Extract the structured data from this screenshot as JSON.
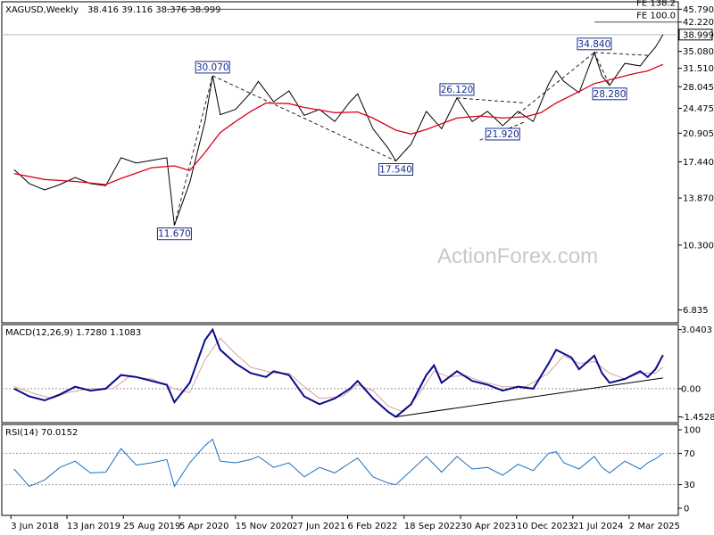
{
  "header": {
    "symbol": "XAGUSD,Weekly",
    "ohlc": "38.416 39.116 38.376 38.999"
  },
  "watermark": "ActionForex.com",
  "colors": {
    "price": "#000000",
    "sma": "#d9001b",
    "macd": "#0a0a8c",
    "signal": "#d9a0a0",
    "rsi": "#1a6fc2",
    "label_border": "#1a2d8f",
    "fib_line": "#3a4f6e"
  },
  "chart_data": [
    {
      "panel": "price",
      "type": "line",
      "title": "XAGUSD,Weekly 38.416 39.116 38.376 38.999",
      "y_scale": "log",
      "ylim": [
        6.3,
        48.0
      ],
      "y_ticks": [
        "45.790",
        "42.220",
        "38.999",
        "35.080",
        "31.510",
        "28.045",
        "24.475",
        "20.905",
        "17.440",
        "13.870",
        "10.300",
        "6.835"
      ],
      "y_tick_values": [
        45.79,
        42.22,
        38.999,
        35.08,
        31.51,
        28.045,
        24.475,
        20.905,
        17.44,
        13.87,
        10.3,
        6.835
      ],
      "x_labels": [
        "3 Jun 2018",
        "13 Jan 2019",
        "25 Aug 2019",
        "5 Apr 2020",
        "15 Nov 2020",
        "27 Jun 2021",
        "6 Feb 2022",
        "18 Sep 2022",
        "30 Apr 2023",
        "10 Dec 2023",
        "21 Jul 2024",
        "2 Mar 2025"
      ],
      "price_path": [
        [
          "Jun 2018",
          16.6
        ],
        [
          "Aug 2018",
          15.2
        ],
        [
          "Oct 2018",
          14.6
        ],
        [
          "Dec 2018",
          15.1
        ],
        [
          "Feb 2019",
          15.8
        ],
        [
          "Apr 2019",
          15.2
        ],
        [
          "Jun 2019",
          15.0
        ],
        [
          "Aug 2019",
          17.9
        ],
        [
          "Oct 2019",
          17.3
        ],
        [
          "Dec 2019",
          17.6
        ],
        [
          "Feb 2020",
          17.9
        ],
        [
          "Mar 2020",
          11.67
        ],
        [
          "May 2020",
          15.3
        ],
        [
          "Jul 2020",
          22.5
        ],
        [
          "Aug 2020",
          30.07
        ],
        [
          "Sep 2020",
          23.5
        ],
        [
          "Nov 2020",
          24.3
        ],
        [
          "Jan 2021",
          27.0
        ],
        [
          "Feb 2021",
          29.0
        ],
        [
          "Apr 2021",
          25.5
        ],
        [
          "Jun 2021",
          27.3
        ],
        [
          "Aug 2021",
          23.4
        ],
        [
          "Oct 2021",
          24.3
        ],
        [
          "Dec 2021",
          22.5
        ],
        [
          "Feb 2022",
          25.5
        ],
        [
          "Mar 2022",
          26.8
        ],
        [
          "May 2022",
          21.5
        ],
        [
          "Jul 2022",
          19.0
        ],
        [
          "Aug 2022",
          17.54
        ],
        [
          "Oct 2022",
          19.5
        ],
        [
          "Dec 2022",
          24.0
        ],
        [
          "Feb 2023",
          21.5
        ],
        [
          "Apr 2023",
          26.12
        ],
        [
          "Jun 2023",
          22.5
        ],
        [
          "Aug 2023",
          24.0
        ],
        [
          "Oct 2023",
          21.92
        ],
        [
          "Dec 2023",
          24.0
        ],
        [
          "Feb 2024",
          22.5
        ],
        [
          "Apr 2024",
          28.5
        ],
        [
          "May 2024",
          31.0
        ],
        [
          "Jun 2024",
          29.0
        ],
        [
          "Aug 2024",
          27.0
        ],
        [
          "Oct 2024",
          34.84
        ],
        [
          "Nov 2024",
          30.0
        ],
        [
          "Dec 2024",
          28.28
        ],
        [
          "Feb 2025",
          32.5
        ],
        [
          "Apr 2025",
          32.0
        ],
        [
          "May 2025",
          34.0
        ],
        [
          "Jun 2025",
          36.0
        ],
        [
          "Jul 2025",
          38.999
        ]
      ],
      "sma_path": [
        [
          "Jun 2018",
          16.2
        ],
        [
          "Oct 2018",
          15.6
        ],
        [
          "Feb 2019",
          15.4
        ],
        [
          "Jun 2019",
          15.1
        ],
        [
          "Aug 2019",
          15.7
        ],
        [
          "Dec 2019",
          16.8
        ],
        [
          "Mar 2020",
          17.0
        ],
        [
          "May 2020",
          16.5
        ],
        [
          "Jul 2020",
          18.5
        ],
        [
          "Sep 2020",
          21.0
        ],
        [
          "Nov 2020",
          22.5
        ],
        [
          "Jan 2021",
          24.0
        ],
        [
          "Mar 2021",
          25.3
        ],
        [
          "Jun 2021",
          25.2
        ],
        [
          "Aug 2021",
          24.6
        ],
        [
          "Oct 2021",
          24.2
        ],
        [
          "Dec 2021",
          23.8
        ],
        [
          "Mar 2022",
          23.9
        ],
        [
          "May 2022",
          23.0
        ],
        [
          "Aug 2022",
          21.3
        ],
        [
          "Oct 2022",
          20.8
        ],
        [
          "Dec 2022",
          21.4
        ],
        [
          "Feb 2023",
          22.2
        ],
        [
          "Apr 2023",
          23.0
        ],
        [
          "Jul 2023",
          23.3
        ],
        [
          "Oct 2023",
          23.0
        ],
        [
          "Jan 2024",
          23.2
        ],
        [
          "Mar 2024",
          23.8
        ],
        [
          "May 2024",
          25.3
        ],
        [
          "Aug 2024",
          27.2
        ],
        [
          "Oct 2024",
          28.6
        ],
        [
          "Dec 2024",
          29.3
        ],
        [
          "Mar 2025",
          30.4
        ],
        [
          "May 2025",
          31.0
        ],
        [
          "Jul 2025",
          32.3
        ]
      ],
      "labels": [
        {
          "text": "30.070",
          "at": [
            "Aug 2020",
            30.07
          ],
          "pos": "above"
        },
        {
          "text": "11.670",
          "at": [
            "Mar 2020",
            11.67
          ],
          "pos": "below"
        },
        {
          "text": "17.540",
          "at": [
            "Aug 2022",
            17.54
          ],
          "pos": "below"
        },
        {
          "text": "26.120",
          "at": [
            "Apr 2023",
            26.12
          ],
          "pos": "above"
        },
        {
          "text": "21.920",
          "at": [
            "Oct 2023",
            21.92
          ],
          "pos": "below"
        },
        {
          "text": "34.840",
          "at": [
            "Oct 2024",
            34.84
          ],
          "pos": "above"
        },
        {
          "text": "28.280",
          "at": [
            "Dec 2024",
            28.28
          ],
          "pos": "below"
        }
      ],
      "fib_levels": [
        {
          "name": "FE 138.2",
          "value": 45.79,
          "from": "Feb 2020"
        },
        {
          "name": "FE 100.0",
          "value": 42.22,
          "from": "Oct 2024"
        }
      ],
      "last_price": {
        "value": 38.999,
        "label": "38.999"
      },
      "trend_lines": [
        {
          "from": [
            "Mar 2020",
            11.67
          ],
          "to": [
            "Aug 2020",
            30.07
          ]
        },
        {
          "from": [
            "Aug 2020",
            30.07
          ],
          "to": [
            "Aug 2022",
            17.54
          ]
        },
        {
          "from": [
            "Apr 2023",
            26.12
          ],
          "to": [
            "Jan 2024",
            25.3
          ]
        },
        {
          "from": [
            "Jul 2023",
            20.0
          ],
          "to": [
            "Jan 2024",
            22.5
          ]
        },
        {
          "from": [
            "Dec 2023",
            23.6
          ],
          "to": [
            "Oct 2024",
            34.84
          ]
        },
        {
          "from": [
            "Oct 2024",
            34.84
          ],
          "to": [
            "Dec 2024",
            28.28
          ]
        },
        {
          "from": [
            "Oct 2024",
            34.84
          ],
          "to": [
            "May 2025",
            34.2
          ]
        }
      ]
    },
    {
      "panel": "macd",
      "type": "line",
      "title": "MACD(12,26,9) 1.7280 1.1083",
      "ylim": [
        -1.75,
        3.3
      ],
      "y_ticks": [
        "3.0403",
        "0.00",
        "-1.4528"
      ],
      "y_tick_values": [
        3.0403,
        0.0,
        -1.4528
      ],
      "macd": [
        [
          "Jun 2018",
          0.0
        ],
        [
          "Aug 2018",
          -0.4
        ],
        [
          "Oct 2018",
          -0.6
        ],
        [
          "Dec 2018",
          -0.3
        ],
        [
          "Feb 2019",
          0.1
        ],
        [
          "Apr 2019",
          -0.1
        ],
        [
          "Jun 2019",
          0.0
        ],
        [
          "Aug 2019",
          0.7
        ],
        [
          "Oct 2019",
          0.6
        ],
        [
          "Dec 2019",
          0.4
        ],
        [
          "Feb 2020",
          0.2
        ],
        [
          "Mar 2020",
          -0.7
        ],
        [
          "May 2020",
          0.3
        ],
        [
          "Jul 2020",
          2.5
        ],
        [
          "Aug 2020",
          3.04
        ],
        [
          "Sep 2020",
          2.0
        ],
        [
          "Nov 2020",
          1.3
        ],
        [
          "Jan 2021",
          0.8
        ],
        [
          "Mar 2021",
          0.6
        ],
        [
          "Apr 2021",
          0.9
        ],
        [
          "Jun 2021",
          0.7
        ],
        [
          "Aug 2021",
          -0.4
        ],
        [
          "Oct 2021",
          -0.8
        ],
        [
          "Dec 2021",
          -0.5
        ],
        [
          "Feb 2022",
          0.0
        ],
        [
          "Mar 2022",
          0.4
        ],
        [
          "May 2022",
          -0.5
        ],
        [
          "Jul 2022",
          -1.2
        ],
        [
          "Aug 2022",
          -1.45
        ],
        [
          "Oct 2022",
          -0.8
        ],
        [
          "Dec 2022",
          0.7
        ],
        [
          "Jan 2023",
          1.2
        ],
        [
          "Feb 2023",
          0.3
        ],
        [
          "Apr 2023",
          0.9
        ],
        [
          "Jun 2023",
          0.4
        ],
        [
          "Aug 2023",
          0.2
        ],
        [
          "Oct 2023",
          -0.1
        ],
        [
          "Dec 2023",
          0.1
        ],
        [
          "Feb 2024",
          0.0
        ],
        [
          "Apr 2024",
          1.3
        ],
        [
          "May 2024",
          2.0
        ],
        [
          "Jul 2024",
          1.6
        ],
        [
          "Aug 2024",
          1.0
        ],
        [
          "Oct 2024",
          1.7
        ],
        [
          "Nov 2024",
          0.8
        ],
        [
          "Dec 2024",
          0.3
        ],
        [
          "Feb 2025",
          0.5
        ],
        [
          "Apr 2025",
          0.9
        ],
        [
          "May 2025",
          0.6
        ],
        [
          "Jun 2025",
          1.0
        ],
        [
          "Jul 2025",
          1.728
        ]
      ],
      "signal": [
        [
          "Jun 2018",
          0.1
        ],
        [
          "Sep 2018",
          -0.3
        ],
        [
          "Nov 2018",
          -0.5
        ],
        [
          "Jan 2019",
          -0.2
        ],
        [
          "Apr 2019",
          0.0
        ],
        [
          "Jul 2019",
          0.0
        ],
        [
          "Sep 2019",
          0.6
        ],
        [
          "Dec 2019",
          0.5
        ],
        [
          "Mar 2020",
          0.0
        ],
        [
          "May 2020",
          -0.2
        ],
        [
          "Jul 2020",
          1.5
        ],
        [
          "Sep 2020",
          2.6
        ],
        [
          "Nov 2020",
          1.8
        ],
        [
          "Jan 2021",
          1.1
        ],
        [
          "Apr 2021",
          0.8
        ],
        [
          "Jun 2021",
          0.8
        ],
        [
          "Aug 2021",
          0.1
        ],
        [
          "Oct 2021",
          -0.5
        ],
        [
          "Jan 2022",
          -0.4
        ],
        [
          "Mar 2022",
          0.2
        ],
        [
          "May 2022",
          -0.1
        ],
        [
          "Jul 2022",
          -0.9
        ],
        [
          "Sep 2022",
          -1.2
        ],
        [
          "Nov 2022",
          -0.3
        ],
        [
          "Jan 2023",
          0.9
        ],
        [
          "Mar 2023",
          0.6
        ],
        [
          "May 2023",
          0.7
        ],
        [
          "Jul 2023",
          0.4
        ],
        [
          "Oct 2023",
          0.1
        ],
        [
          "Jan 2024",
          0.1
        ],
        [
          "Apr 2024",
          0.8
        ],
        [
          "Jun 2024",
          1.7
        ],
        [
          "Aug 2024",
          1.3
        ],
        [
          "Oct 2024",
          1.4
        ],
        [
          "Dec 2024",
          0.8
        ],
        [
          "Feb 2025",
          0.5
        ],
        [
          "Apr 2025",
          0.8
        ],
        [
          "Jun 2025",
          0.8
        ],
        [
          "Jul 2025",
          1.108
        ]
      ],
      "trend_line": {
        "from": [
          "Aug 2022",
          -1.45
        ],
        "to": [
          "Jul 2025",
          0.55
        ]
      }
    },
    {
      "panel": "rsi",
      "type": "line",
      "title": "RSI(14) 70.0152",
      "ylim": [
        0,
        100
      ],
      "y_ticks": [
        "100",
        "70",
        "30",
        "0"
      ],
      "y_tick_values": [
        100,
        70,
        30,
        0
      ],
      "levels": [
        70,
        30
      ],
      "rsi": [
        [
          "Jun 2018",
          50
        ],
        [
          "Aug 2018",
          28
        ],
        [
          "Oct 2018",
          36
        ],
        [
          "Dec 2018",
          52
        ],
        [
          "Feb 2019",
          60
        ],
        [
          "Apr 2019",
          45
        ],
        [
          "Jun 2019",
          46
        ],
        [
          "Aug 2019",
          76
        ],
        [
          "Oct 2019",
          55
        ],
        [
          "Dec 2019",
          58
        ],
        [
          "Feb 2020",
          62
        ],
        [
          "Mar 2020",
          28
        ],
        [
          "May 2020",
          58
        ],
        [
          "Jul 2020",
          80
        ],
        [
          "Aug 2020",
          88
        ],
        [
          "Sep 2020",
          60
        ],
        [
          "Nov 2020",
          58
        ],
        [
          "Jan 2021",
          62
        ],
        [
          "Feb 2021",
          66
        ],
        [
          "Apr 2021",
          52
        ],
        [
          "Jun 2021",
          58
        ],
        [
          "Aug 2021",
          40
        ],
        [
          "Oct 2021",
          52
        ],
        [
          "Dec 2021",
          45
        ],
        [
          "Feb 2022",
          58
        ],
        [
          "Mar 2022",
          64
        ],
        [
          "May 2022",
          40
        ],
        [
          "Jul 2022",
          32
        ],
        [
          "Aug 2022",
          30
        ],
        [
          "Oct 2022",
          48
        ],
        [
          "Dec 2022",
          66
        ],
        [
          "Feb 2023",
          46
        ],
        [
          "Apr 2023",
          66
        ],
        [
          "Jun 2023",
          50
        ],
        [
          "Aug 2023",
          52
        ],
        [
          "Oct 2023",
          42
        ],
        [
          "Dec 2023",
          56
        ],
        [
          "Feb 2024",
          48
        ],
        [
          "Apr 2024",
          70
        ],
        [
          "May 2024",
          72
        ],
        [
          "Jun 2024",
          58
        ],
        [
          "Aug 2024",
          50
        ],
        [
          "Oct 2024",
          66
        ],
        [
          "Nov 2024",
          52
        ],
        [
          "Dec 2024",
          45
        ],
        [
          "Feb 2025",
          60
        ],
        [
          "Apr 2025",
          50
        ],
        [
          "May 2025",
          58
        ],
        [
          "Jun 2025",
          63
        ],
        [
          "Jul 2025",
          70.0152
        ]
      ]
    }
  ]
}
